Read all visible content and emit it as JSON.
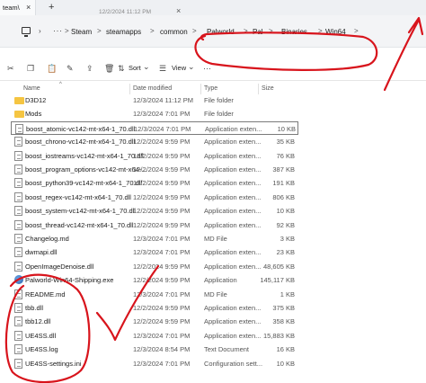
{
  "window": {
    "tab_title": "team\\",
    "tab_close": "×",
    "new_tab": "+",
    "sub_title_fragment": "12/2/2024 11:12 PM",
    "sub_close": "×"
  },
  "address": {
    "root_chevron": "›",
    "more": "···",
    "breadcrumbs": [
      "Steam",
      "steamapps",
      "common",
      "Palworld",
      "Pal",
      "Binaries",
      "Win64"
    ],
    "separator": ">",
    "end_chevron": ">"
  },
  "toolbar": {
    "sort_label": "Sort",
    "view_label": "View",
    "more": "···",
    "dropdown": "⌄"
  },
  "columns": {
    "name": "Name",
    "date_modified": "Date modified",
    "type": "Type",
    "size": "Size"
  },
  "files": [
    {
      "name": "D3D12",
      "date": "12/3/2024 11:12 PM",
      "type": "File folder",
      "size": "",
      "icon": "folder-icon"
    },
    {
      "name": "Mods",
      "date": "12/3/2024 7:01 PM",
      "type": "File folder",
      "size": "",
      "icon": "folder-icon"
    },
    {
      "name": "boost_atomic-vc142-mt-x64-1_70.dll",
      "date": "12/3/2024 7:01 PM",
      "type": "Application exten...",
      "size": "10 KB",
      "icon": "dll-file-icon"
    },
    {
      "name": "boost_chrono-vc142-mt-x64-1_70.dll",
      "date": "12/2/2024 9:59 PM",
      "type": "Application exten...",
      "size": "35 KB",
      "icon": "dll-file-icon"
    },
    {
      "name": "boost_iostreams-vc142-mt-x64-1_70.dll",
      "date": "12/2/2024 9:59 PM",
      "type": "Application exten...",
      "size": "76 KB",
      "icon": "dll-file-icon"
    },
    {
      "name": "boost_program_options-vc142-mt-x64-...",
      "date": "12/2/2024 9:59 PM",
      "type": "Application exten...",
      "size": "387 KB",
      "icon": "dll-file-icon"
    },
    {
      "name": "boost_python39-vc142-mt-x64-1_70.dll",
      "date": "12/2/2024 9:59 PM",
      "type": "Application exten...",
      "size": "191 KB",
      "icon": "dll-file-icon"
    },
    {
      "name": "boost_regex-vc142-mt-x64-1_70.dll",
      "date": "12/2/2024 9:59 PM",
      "type": "Application exten...",
      "size": "806 KB",
      "icon": "dll-file-icon"
    },
    {
      "name": "boost_system-vc142-mt-x64-1_70.dll",
      "date": "12/2/2024 9:59 PM",
      "type": "Application exten...",
      "size": "10 KB",
      "icon": "dll-file-icon"
    },
    {
      "name": "boost_thread-vc142-mt-x64-1_70.dll",
      "date": "12/2/2024 9:59 PM",
      "type": "Application exten...",
      "size": "92 KB",
      "icon": "dll-file-icon"
    },
    {
      "name": "Changelog.md",
      "date": "12/3/2024 7:01 PM",
      "type": "MD File",
      "size": "3 KB",
      "icon": "md-file-icon"
    },
    {
      "name": "dwmapi.dll",
      "date": "12/3/2024 7:01 PM",
      "type": "Application exten...",
      "size": "23 KB",
      "icon": "dll-file-icon"
    },
    {
      "name": "OpenImageDenoise.dll",
      "date": "12/2/2024 9:59 PM",
      "type": "Application exten...",
      "size": "48,605 KB",
      "icon": "dll-file-icon"
    },
    {
      "name": "Palworld-Win64-Shipping.exe",
      "date": "12/2/2024 9:59 PM",
      "type": "Application",
      "size": "145,117 KB",
      "icon": "exe-file-icon"
    },
    {
      "name": "README.md",
      "date": "12/3/2024 7:01 PM",
      "type": "MD File",
      "size": "1 KB",
      "icon": "md-file-icon"
    },
    {
      "name": "tbb.dll",
      "date": "12/2/2024 9:59 PM",
      "type": "Application exten...",
      "size": "375 KB",
      "icon": "dll-file-icon"
    },
    {
      "name": "tbb12.dll",
      "date": "12/2/2024 9:59 PM",
      "type": "Application exten...",
      "size": "358 KB",
      "icon": "dll-file-icon"
    },
    {
      "name": "UE4SS.dll",
      "date": "12/3/2024 7:01 PM",
      "type": "Application exten...",
      "size": "15,883 KB",
      "icon": "dll-file-icon"
    },
    {
      "name": "UE4SS.log",
      "date": "12/3/2024 8:54 PM",
      "type": "Text Document",
      "size": "16 KB",
      "icon": "log-file-icon"
    },
    {
      "name": "UE4SS-settings.ini",
      "date": "12/3/2024 7:01 PM",
      "type": "Configuration sett...",
      "size": "10 KB",
      "icon": "ini-file-icon"
    }
  ],
  "colors": {
    "annotation": "#d8141c",
    "folder": "#f5c542",
    "selection_border": "#7a7a7a"
  }
}
